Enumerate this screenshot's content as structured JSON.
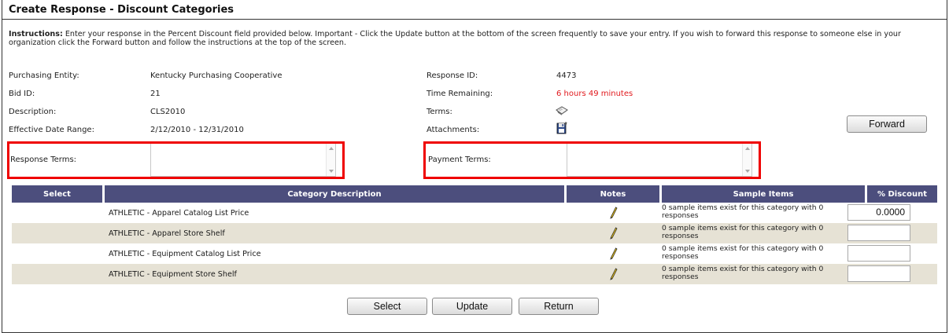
{
  "page": {
    "title": "Create Response - Discount Categories",
    "instructions_label": "Instructions:",
    "instructions_text": " Enter your response in the Percent Discount field provided below.  Important - Click the Update button at the bottom of the screen frequently to save your entry.  If you wish to forward this response to someone else in your organization click the Forward button and follow the instructions at the top of the screen."
  },
  "info": {
    "purchasing_entity_label": "Purchasing Entity:",
    "purchasing_entity_value": "Kentucky Purchasing Cooperative",
    "bid_id_label": "Bid ID:",
    "bid_id_value": "21",
    "description_label": "Description:",
    "description_value": "CLS2010",
    "effective_date_label": "Effective Date Range:",
    "effective_date_value": "2/12/2010 - 12/31/2010",
    "response_id_label": "Response ID:",
    "response_id_value": "4473",
    "time_remaining_label": "Time Remaining:",
    "time_remaining_value": "6 hours 49 minutes",
    "terms_label": "Terms:",
    "attachments_label": "Attachments:",
    "forward_label": "Forward"
  },
  "terms_fields": {
    "response_terms_label": "Response Terms:",
    "payment_terms_label": "Payment Terms:"
  },
  "grid": {
    "headers": {
      "select": "Select",
      "description": "Category Description",
      "notes": "Notes",
      "sample": "Sample Items",
      "discount": "% Discount"
    },
    "rows": [
      {
        "description": "ATHLETIC - Apparel Catalog List Price",
        "sample": "0 sample items exist for this category with 0 responses",
        "discount": "0.0000"
      },
      {
        "description": "ATHLETIC - Apparel Store Shelf",
        "sample": "0 sample items exist for this category with 0 responses",
        "discount": ""
      },
      {
        "description": "ATHLETIC - Equipment Catalog List Price",
        "sample": "0 sample items exist for this category with 0 responses",
        "discount": ""
      },
      {
        "description": "ATHLETIC - Equipment Store Shelf",
        "sample": "0 sample items exist for this category with 0 responses",
        "discount": ""
      }
    ]
  },
  "buttons": {
    "select": "Select",
    "update": "Update",
    "return": "Return"
  },
  "icons": {
    "terms": "book-icon",
    "attachments": "floppy-disk-icon",
    "notes": "pencil-icon"
  },
  "colors": {
    "header_bg": "#4c4e7d",
    "alt_row_bg": "#e6e2d5",
    "highlight_red": "#ef0000",
    "time_red": "#e1191d"
  }
}
